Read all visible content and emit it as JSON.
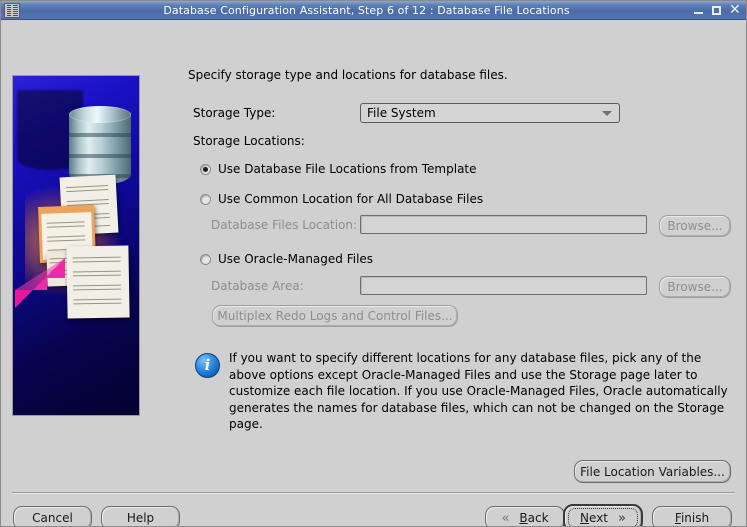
{
  "window": {
    "title": "Database Configuration Assistant, Step 6 of 12 : Database File Locations",
    "icon": "app-icon",
    "minimize_label": "–",
    "maximize_label": "□",
    "close_label": "✕"
  },
  "page": {
    "heading": "Specify storage type and locations for database files.",
    "storage_type_label": "Storage Type:",
    "storage_type_value": "File System",
    "storage_type_options": [
      "File System"
    ],
    "storage_locations_label": "Storage Locations:"
  },
  "options": [
    {
      "id": "template",
      "label": "Use Database File Locations from Template",
      "selected": true
    },
    {
      "id": "common",
      "label": "Use Common Location for All Database Files",
      "selected": false,
      "field_label": "Database Files Location:",
      "field_value": "",
      "field_enabled": false,
      "browse_label": "Browse...",
      "browse_enabled": false
    },
    {
      "id": "omf",
      "label": "Use Oracle-Managed Files",
      "selected": false,
      "field_label": "Database Area:",
      "field_value": "",
      "field_enabled": false,
      "browse_label": "Browse...",
      "browse_enabled": false
    }
  ],
  "multiplex_button": {
    "label": "Multiplex Redo Logs and Control Files...",
    "enabled": false
  },
  "info": {
    "icon": "info-icon",
    "text": "If you want to specify different locations for any database files, pick any of the above options except Oracle-Managed Files and use the Storage page later to customize each file location. If you use Oracle-Managed Files, Oracle automatically generates the names for database files, which can not be changed on the Storage page."
  },
  "file_location_variables_button": {
    "label": "File Location Variables...",
    "enabled": true
  },
  "footer": {
    "cancel": "Cancel",
    "help": "Help",
    "back": "Back",
    "back_mnemonic": "B",
    "next": "Next",
    "next_mnemonic": "N",
    "finish": "Finish",
    "finish_mnemonic": "F",
    "back_chevron": "«",
    "next_chevron": "»",
    "default_button": "next"
  },
  "colors": {
    "titlebar": "#4a6ca8",
    "background": "#d0d0d0",
    "sidebar_blue": "#0d0891",
    "accent_orange": "#f0a15a",
    "arrow_magenta": "#e8189b",
    "info_blue": "#2e8de0",
    "disabled_text": "#8d8d8d"
  }
}
